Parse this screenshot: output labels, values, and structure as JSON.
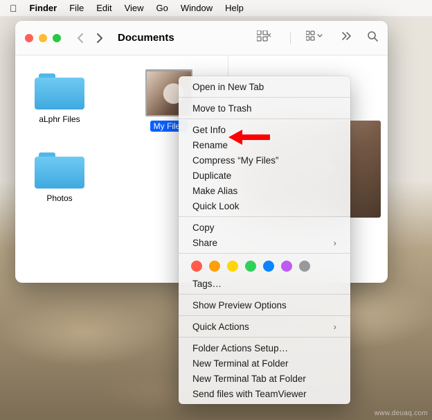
{
  "menubar": {
    "app": "Finder",
    "items": [
      "File",
      "Edit",
      "View",
      "Go",
      "Window",
      "Help"
    ]
  },
  "window": {
    "title": "Documents",
    "items": [
      {
        "name": "aLphr Files",
        "kind": "folder",
        "selected": false
      },
      {
        "name": "My Files",
        "kind": "image",
        "selected": true
      },
      {
        "name": "Photos",
        "kind": "folder",
        "selected": false
      }
    ]
  },
  "context_menu": {
    "groups": [
      [
        "Open in New Tab"
      ],
      [
        "Move to Trash"
      ],
      [
        "Get Info",
        "Rename",
        "Compress “My Files”",
        "Duplicate",
        "Make Alias",
        "Quick Look"
      ],
      [
        "Copy",
        {
          "label": "Share",
          "submenu": true
        }
      ]
    ],
    "tag_colors": [
      "#ff5b4b",
      "#ff9f0a",
      "#ffd60a",
      "#30d158",
      "#0a84ff",
      "#bf5af2",
      "#98989d"
    ],
    "tags_label": "Tags…",
    "after_tags": [
      [
        "Show Preview Options"
      ],
      [
        {
          "label": "Quick Actions",
          "submenu": true
        }
      ],
      [
        "Folder Actions Setup…",
        "New Terminal at Folder",
        "New Terminal Tab at Folder",
        "Send files with TeamViewer"
      ]
    ]
  },
  "highlight": "Get Info",
  "watermark": "www.deuaq.com"
}
